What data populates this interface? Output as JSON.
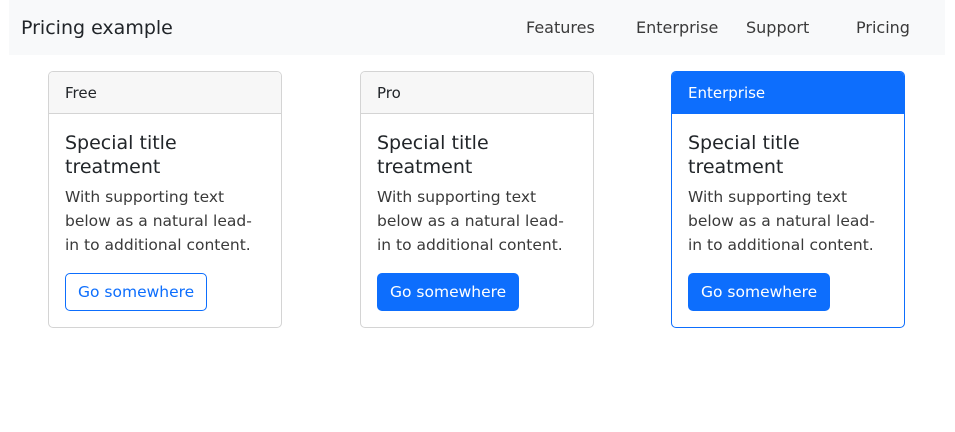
{
  "navbar": {
    "brand": "Pricing example",
    "links": [
      "Features",
      "Enterprise",
      "Support",
      "Pricing"
    ]
  },
  "cards": [
    {
      "header": "Free",
      "title": "Special title treatment",
      "text": "With supporting text below as a natural lead-in to additional content.",
      "button": "Go somewhere",
      "button_style": "outline"
    },
    {
      "header": "Pro",
      "title": "Special title treatment",
      "text": "With supporting text below as a natural lead-in to additional content.",
      "button": "Go somewhere",
      "button_style": "solid"
    },
    {
      "header": "Enterprise",
      "title": "Special title treatment",
      "text": "With supporting text below as a natural lead-in to additional content.",
      "button": "Go somewhere",
      "button_style": "solid",
      "highlighted": true
    }
  ],
  "colors": {
    "primary": "#0d6efd",
    "navbar_bg": "#f8f9fa",
    "card_header_bg": "#f7f7f7",
    "border": "#d4d4d4"
  }
}
